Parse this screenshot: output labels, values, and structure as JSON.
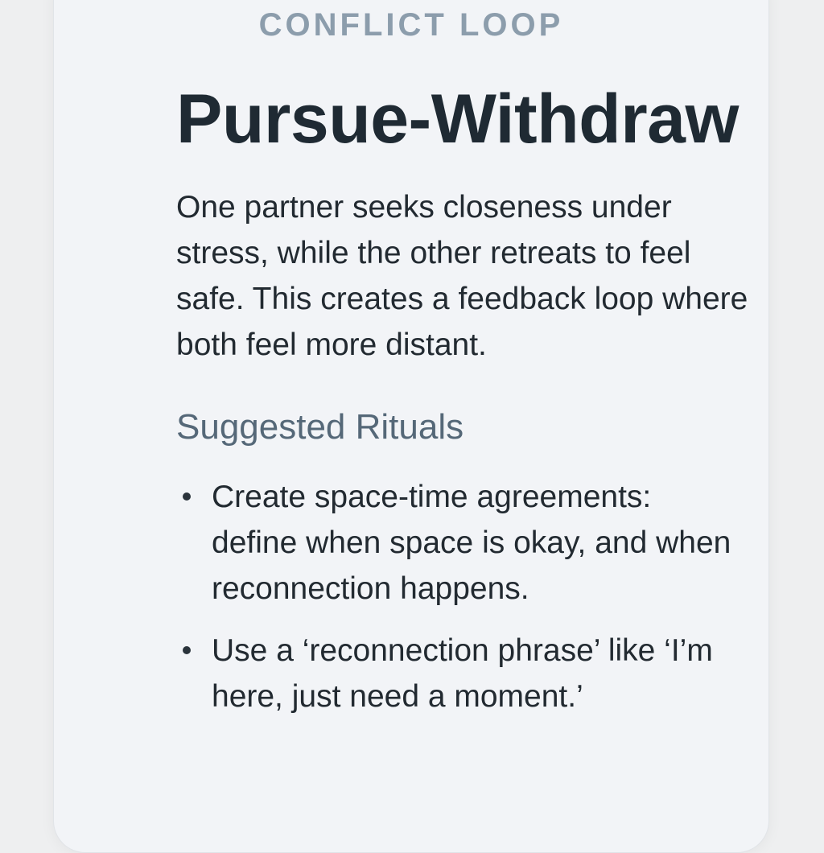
{
  "card": {
    "eyebrow": "CONFLICT LOOP",
    "title": "Pursue-Withdraw",
    "description": "One partner seeks closeness under stress, while the other retreats to feel safe. This creates a feedback loop where both feel more distant.",
    "section_heading": "Suggested Rituals",
    "rituals": [
      "Create space-time agreements: define when space is okay, and when reconnection happens.",
      "Use a ‘reconnection phrase’ like ‘I’m here, just need a moment.’"
    ]
  },
  "colors": {
    "background": "#eeeff0",
    "card": "#f2f4f7",
    "eyebrow": "#8c9dac",
    "title": "#1f2a33",
    "body_text": "#222a31",
    "section_heading": "#556878"
  }
}
